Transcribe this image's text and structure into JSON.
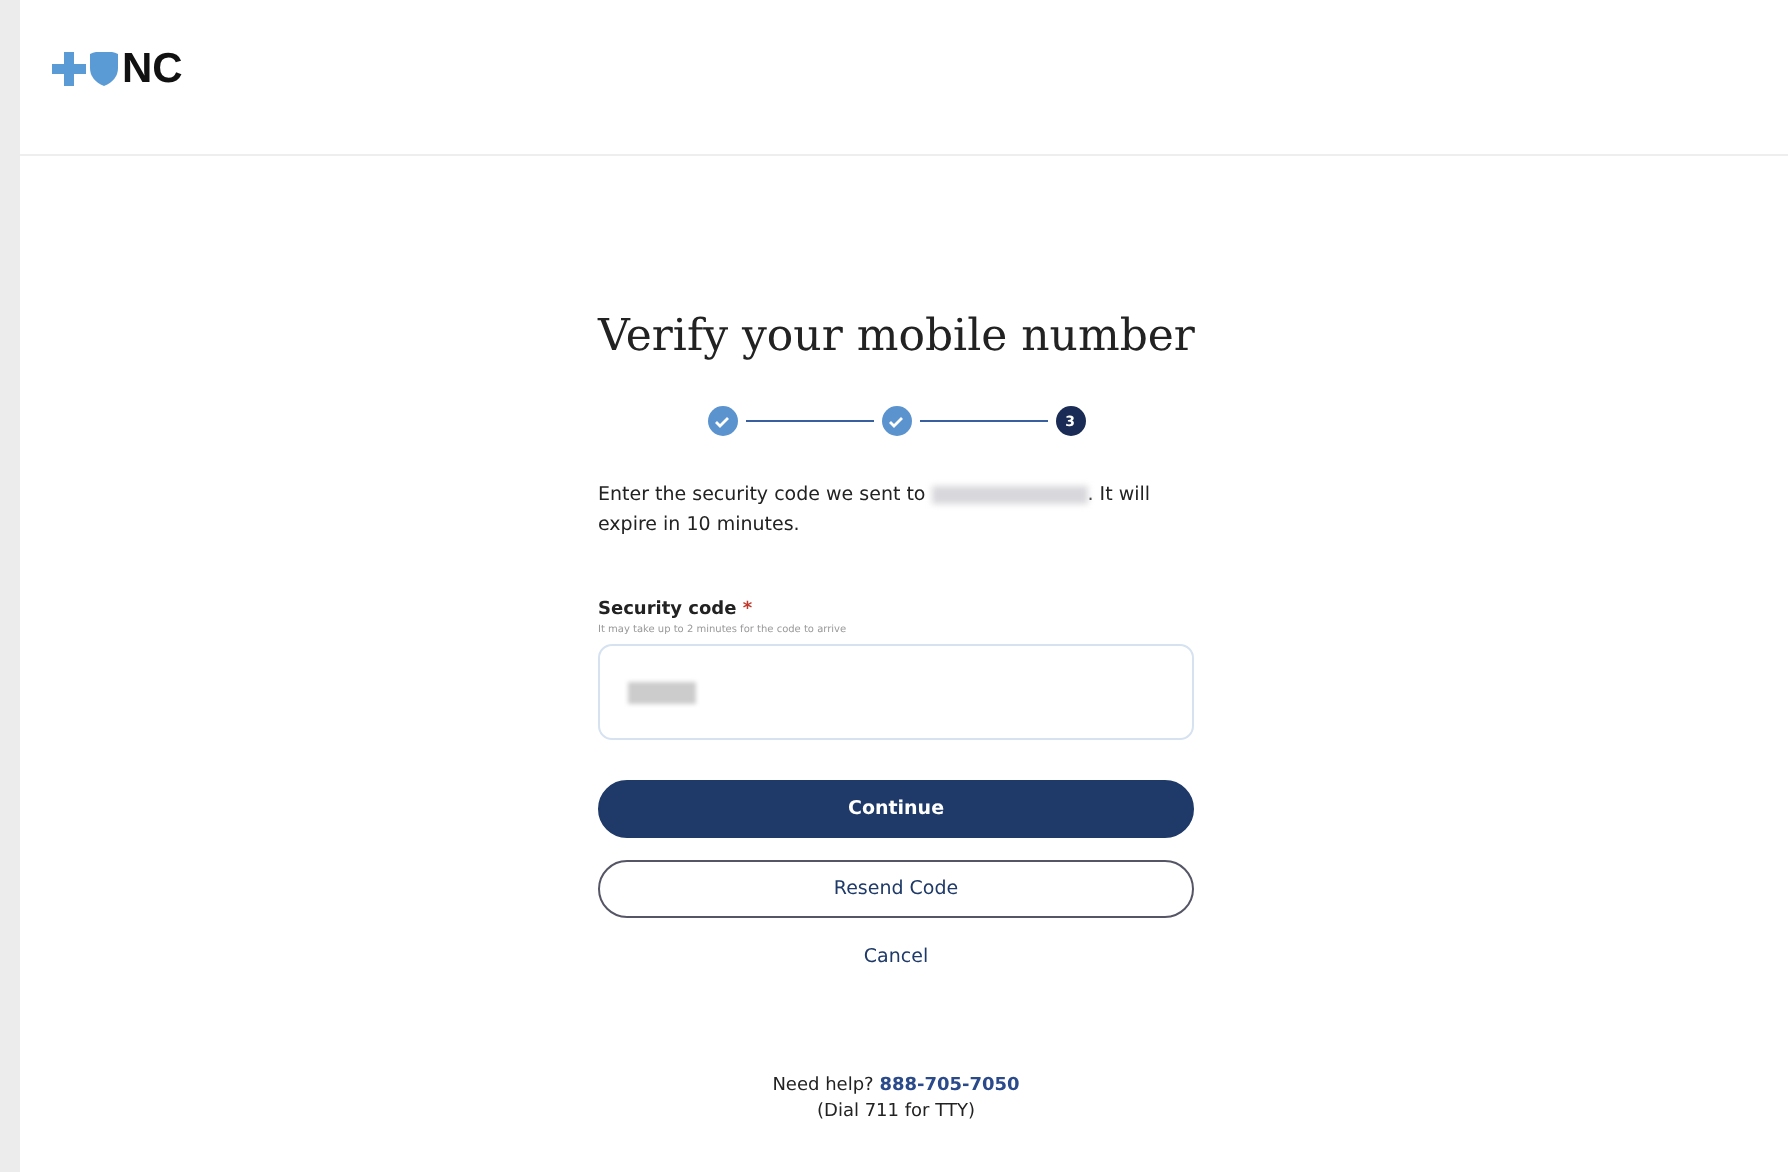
{
  "header": {
    "logo_text": "NC"
  },
  "title": "Verify your mobile number",
  "steps": [
    {
      "done": true
    },
    {
      "done": true
    },
    {
      "label": "3",
      "done": false
    }
  ],
  "instructions": {
    "before": "Enter the security code we sent to",
    "after": ". It will expire in 10 minutes."
  },
  "field": {
    "label": "Security code",
    "required_mark": "*",
    "hint": "It may take up to 2 minutes for the code to arrive"
  },
  "buttons": [
    {
      "label": "Continue",
      "kind": "primary"
    },
    {
      "label": "Resend Code",
      "kind": "outline"
    },
    {
      "label": "Cancel",
      "kind": "link"
    }
  ],
  "help": {
    "text": "Need help?",
    "phone": "888-705-7050",
    "note": "(Dial 711 for TTY)"
  }
}
